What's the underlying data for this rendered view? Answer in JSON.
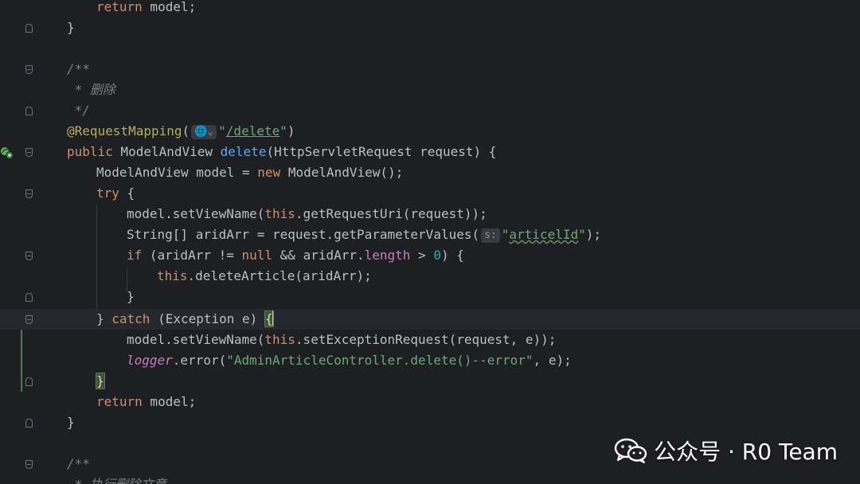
{
  "editor": {
    "lines": {
      "l1": {
        "t1": "return",
        "t2": " model;"
      },
      "l2": {
        "t1": "}"
      },
      "l4": {
        "t1": "/**"
      },
      "l5": {
        "t1": " * 删除"
      },
      "l6": {
        "t1": " */"
      },
      "l7": {
        "t1": "@RequestMapping",
        "t2": "(",
        "hint": "🌐⌄",
        "t3": "\"",
        "t4": "/delete",
        "t5": "\"",
        "t6": ")"
      },
      "l8": {
        "t1": "public",
        "t2": " ModelAndView ",
        "t3": "delete",
        "t4": "(HttpServletRequest request) {"
      },
      "l9": {
        "t1": "ModelAndView model = ",
        "t2": "new",
        "t3": " ModelAndView();"
      },
      "l10": {
        "t1": "try",
        "t2": " {"
      },
      "l11": {
        "t1": "model.setViewName(",
        "t2": "this",
        "t3": ".getRequestUri(request));"
      },
      "l12": {
        "t1": "String[] aridArr = request.getParameterValues(",
        "hint": "s:",
        "t2": "\"",
        "t3": "articelId",
        "t4": "\"",
        "t5": ");"
      },
      "l13": {
        "t1": "if",
        "t2": " (aridArr != ",
        "t3": "null",
        "t4": " && aridArr.",
        "t5": "length",
        "t6": " > ",
        "t7": "0",
        "t8": ") {"
      },
      "l14": {
        "t1": "this",
        "t2": ".deleteArticle(aridArr);"
      },
      "l15": {
        "t1": "}"
      },
      "l16": {
        "t1": "} ",
        "t2": "catch",
        "t3": " (Exception e) ",
        "t4": "{"
      },
      "l17": {
        "t1": "model.setViewName(",
        "t2": "this",
        "t3": ".setExceptionRequest(request, e));"
      },
      "l18": {
        "t1": "logger",
        "t2": ".error(",
        "t3": "\"AdminArticleController.delete()--error\"",
        "t4": ", e);"
      },
      "l19": {
        "t1": "}"
      },
      "l20": {
        "t1": "return",
        "t2": " model;"
      },
      "l21": {
        "t1": "}"
      },
      "l23": {
        "t1": "/**"
      },
      "l24": {
        "t1": " * 执行删除文章"
      }
    }
  },
  "watermark": {
    "text": "公众号 · R0 Team"
  },
  "colors": {
    "background": "#1e1f22",
    "keyword": "#cf8e6d",
    "comment": "#7a7e85",
    "annotation": "#b3ae60",
    "method": "#56a8f5",
    "string": "#6aab73",
    "number": "#2aacb8",
    "field": "#c77dbb"
  }
}
